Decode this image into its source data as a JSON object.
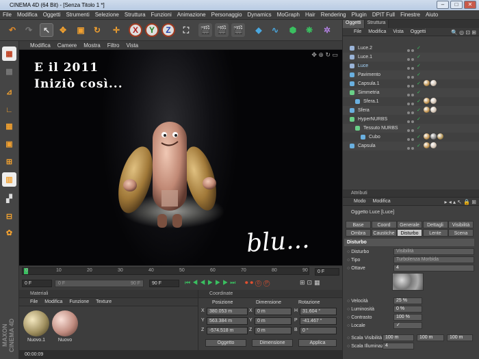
{
  "title": "CINEMA 4D (64 Bit) - [Senza Titolo 1 *]",
  "menu": [
    "File",
    "Modifica",
    "Oggetti",
    "Strumenti",
    "Selezione",
    "Struttura",
    "Funzioni",
    "Animazione",
    "Personaggio",
    "Dynamics",
    "MoGraph",
    "Hair",
    "Rendering",
    "Plugin",
    "DPIT Full",
    "Finestre",
    "Aiuto"
  ],
  "toolbar": {
    "x": "X",
    "y": "Y",
    "z": "Z"
  },
  "viewport": {
    "menu": [
      "Modifica",
      "Camere",
      "Mostra",
      "Filtro",
      "Vista"
    ],
    "text_line1": "E il 2011",
    "text_line2": "Iniziò così...",
    "signature": "blu..."
  },
  "timeline": {
    "ticks": [
      "0",
      "10",
      "20",
      "30",
      "40",
      "50",
      "60",
      "70",
      "80",
      "90"
    ],
    "start_field": "0 F",
    "current_field": "0 F",
    "end_field": "90 F",
    "range_left": "0 F",
    "range_right": "90 F"
  },
  "materials": {
    "header": "Materiali",
    "menu": [
      "File",
      "Modifica",
      "Funzione",
      "Texture"
    ],
    "items": [
      "Nuovo.1",
      "Nuovo"
    ]
  },
  "coordinates": {
    "header": "Coordinate",
    "col_position": "Posizione",
    "col_dimension": "Dimensione",
    "col_rotation": "Rotazione",
    "rows": [
      {
        "axis": "X",
        "pos": "380.053 m",
        "dim_axis": "X",
        "dim": "0 m",
        "rot_axis": "H",
        "rot": "31.604 °"
      },
      {
        "axis": "Y",
        "pos": "563.384 m",
        "dim_axis": "Y",
        "dim": "0 m",
        "rot_axis": "P",
        "rot": "-41.467 °"
      },
      {
        "axis": "Z",
        "pos": "-574.518 m",
        "dim_axis": "Z",
        "dim": "0 m",
        "rot_axis": "B",
        "rot": "0 °"
      }
    ],
    "select_object": "Oggetto",
    "select_size": "Dimensione",
    "apply": "Applica"
  },
  "status": "00:00:09",
  "objects": {
    "tabs": [
      "Oggetti",
      "Struttura"
    ],
    "menu": [
      "File",
      "Modifica",
      "Vista",
      "Oggetti"
    ],
    "items": [
      {
        "name": "Luce.2",
        "indent": 0,
        "icon": "light-icon",
        "color": "#9ab4d8",
        "tags": []
      },
      {
        "name": "Luce.1",
        "indent": 0,
        "icon": "light-icon",
        "color": "#9ab4d8",
        "tags": []
      },
      {
        "name": "Luce",
        "indent": 0,
        "icon": "light-icon",
        "color": "#9ab4d8",
        "tags": [],
        "highlight": true
      },
      {
        "name": "Pavimento",
        "indent": 0,
        "icon": "floor-icon",
        "color": "#6ab0e0",
        "tags": []
      },
      {
        "name": "Capsula.1",
        "indent": 0,
        "icon": "capsule-icon",
        "color": "#6ab0e0",
        "tags": [
          "#c0904a",
          "#d0c0b0"
        ]
      },
      {
        "name": "Simmetria",
        "indent": 0,
        "icon": "symmetry-icon",
        "color": "#6ad088",
        "tags": []
      },
      {
        "name": "Sfera.1",
        "indent": 1,
        "icon": "sphere-icon",
        "color": "#6ab0e0",
        "tags": [
          "#c0904a",
          "#d0c0b0"
        ]
      },
      {
        "name": "Sfera",
        "indent": 0,
        "icon": "sphere-icon",
        "color": "#6ab0e0",
        "tags": [
          "#c0904a",
          "#d0c0b0"
        ]
      },
      {
        "name": "HyperNURBS",
        "indent": 0,
        "icon": "hypernurbs-icon",
        "color": "#6ad088",
        "tags": []
      },
      {
        "name": "Tessuto NURBS",
        "indent": 1,
        "icon": "cloth-nurbs-icon",
        "color": "#6ad088",
        "tags": []
      },
      {
        "name": "Cubo",
        "indent": 2,
        "icon": "cube-icon",
        "color": "#6ab0e0",
        "tags": [
          "#c0904a",
          "#888888",
          "#b09050"
        ]
      },
      {
        "name": "Capsula",
        "indent": 0,
        "icon": "capsule-icon",
        "color": "#6ab0e0",
        "tags": [
          "#c0904a",
          "#d0c0b0"
        ]
      }
    ]
  },
  "attributes": {
    "header": "Attributi",
    "menu": [
      "Modo",
      "Modifica"
    ],
    "object_title": "Oggetto Luce [Luce]",
    "tabs_row1": [
      "Base",
      "Coord",
      "Generale",
      "Dettagli",
      "Visibilità"
    ],
    "tabs_row2": [
      "Ombra",
      "Caustiche",
      "Disturbo",
      "Lente",
      "Scena"
    ],
    "active_tab": "Disturbo",
    "section": "Disturbo",
    "fields": [
      {
        "label": "Disturbo",
        "value": "Visibilità"
      },
      {
        "label": "Tipo",
        "value": "Turbolenza Morbida"
      },
      {
        "label": "Ottave",
        "value": "4"
      },
      {
        "label": "Velocità",
        "value": "25 %"
      },
      {
        "label": "Luminosità",
        "value": "0 %"
      },
      {
        "label": "Contrasto",
        "value": "100 %"
      },
      {
        "label": "Locale",
        "value": "✓"
      },
      {
        "label": "Scala Visibilità",
        "value": "100 m",
        "value2": "100 m",
        "value3": "100 m"
      },
      {
        "label": "Scala Illuminazione",
        "value": "4"
      }
    ]
  }
}
